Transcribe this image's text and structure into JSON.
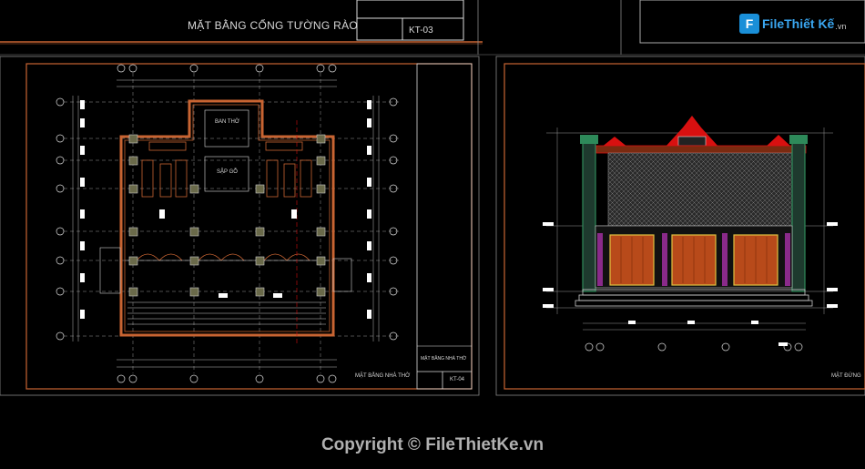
{
  "sheet_top": {
    "title": "MẶT BẰNG CỔNG TƯỜNG RÀO",
    "code": "KT-03"
  },
  "plan_sheet": {
    "title": "MẶT BẰNG NHÀ THỜ",
    "title_block_label": "MẶT BẰNG NHÀ THỜ",
    "code": "KT-04",
    "room_altar": "BAN THỜ",
    "room_bench": "SẬP GỖ",
    "grid_columns": [
      "1",
      "2",
      "3",
      "4",
      "5",
      "6"
    ],
    "grid_rows": [
      "G",
      "G",
      "F",
      "E",
      "D",
      "C",
      "B",
      "A"
    ]
  },
  "elevation_sheet": {
    "title": "MẶT ĐỨNG",
    "grid_columns": [
      "1",
      "2",
      "3",
      "4",
      "5",
      "6"
    ]
  },
  "logo": {
    "mark": "F",
    "text": "FileThiết Kế",
    "suffix": ".vn"
  },
  "copyright": "Copyright © FileThietKe.vn",
  "colors": {
    "background": "#000000",
    "frame": "#c86432",
    "roof": "#d81010",
    "wall_green": "#2e8a5a",
    "door_wood": "#b84a1a",
    "column_purple": "#8a2a8a",
    "line_white": "#e0e0e0",
    "logo_blue": "#1a8fd8"
  }
}
